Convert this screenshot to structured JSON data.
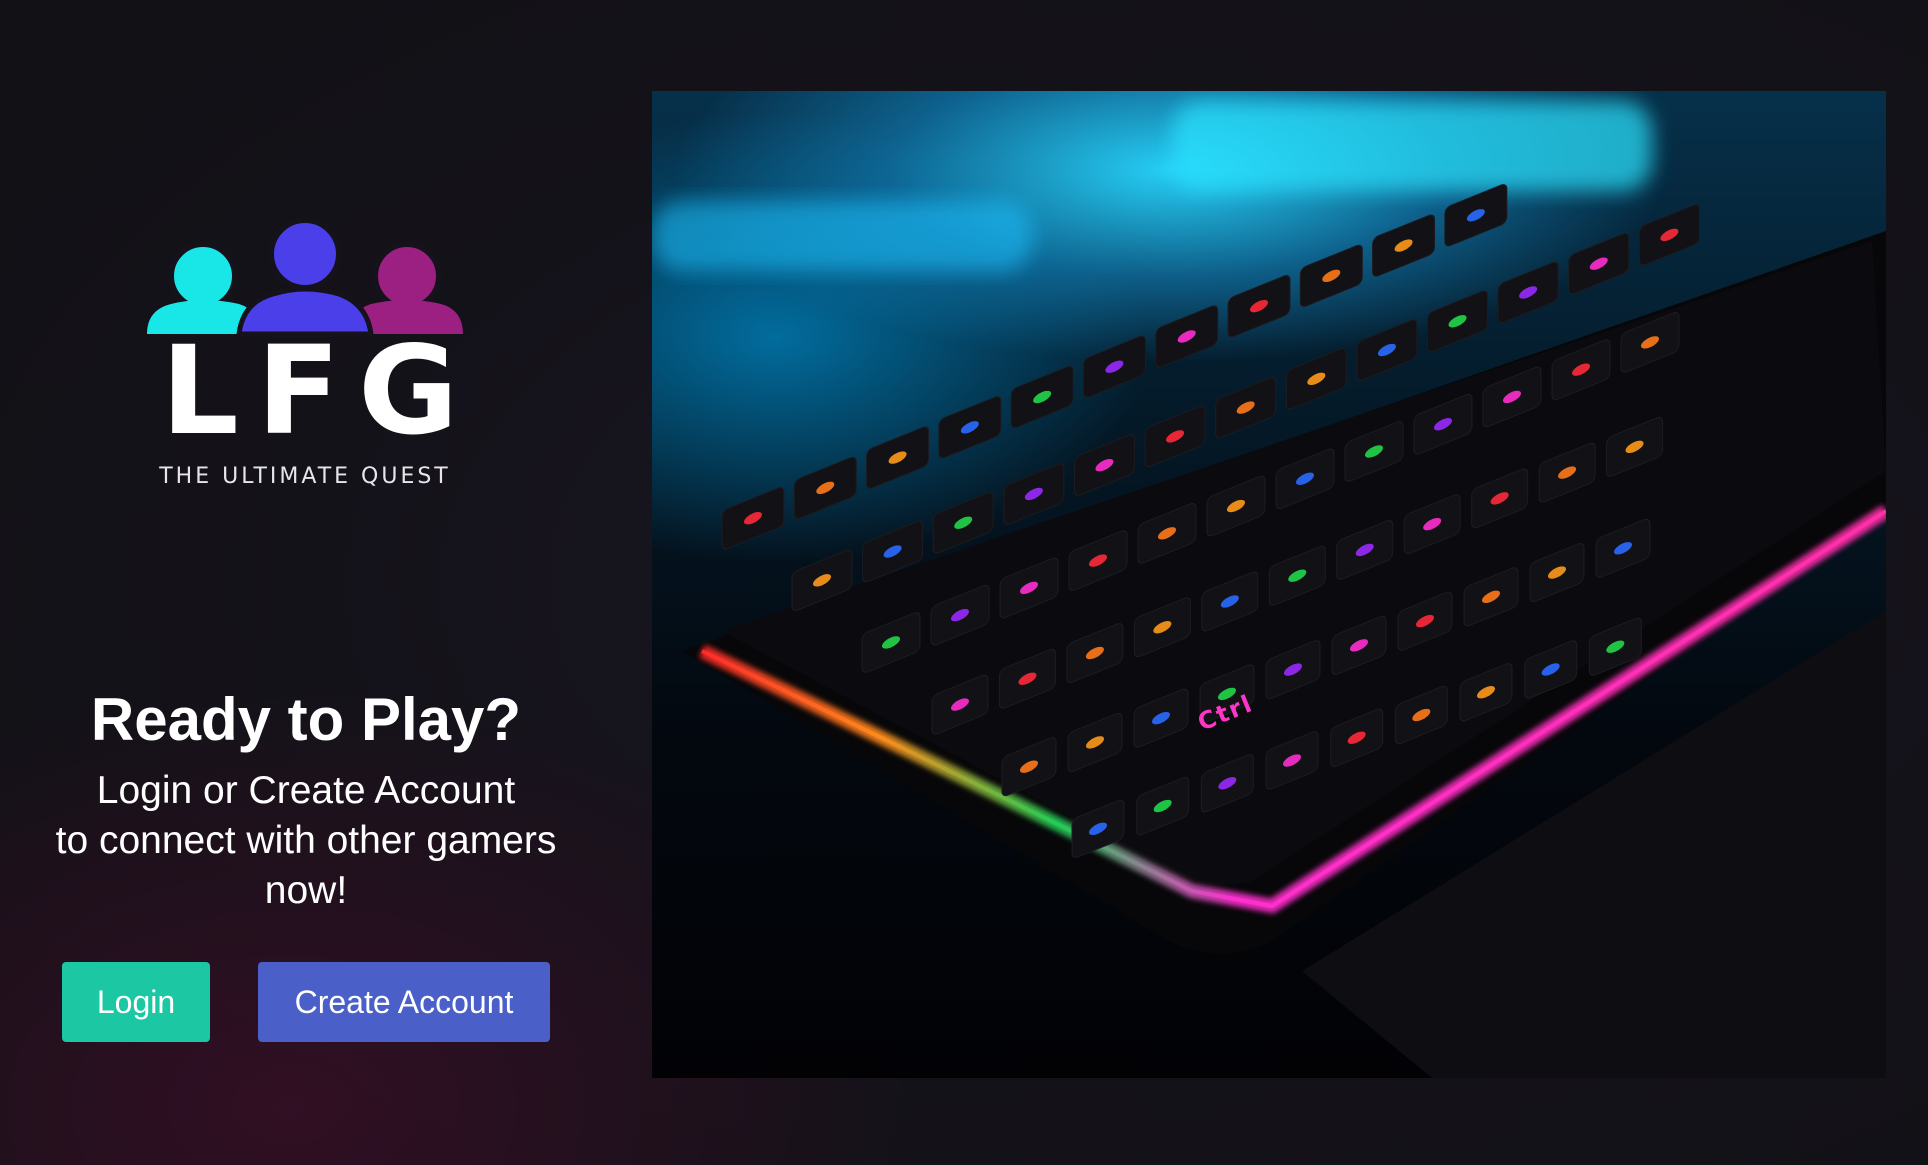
{
  "brand": {
    "logo_text": "LFG",
    "tagline": "THE ULTIMATE QUEST",
    "colors": {
      "person_left": "#19e6e6",
      "person_center": "#4a3fe8",
      "person_right": "#9c1f82"
    }
  },
  "hero_text": {
    "headline": "Ready to Play?",
    "subtext_lines": [
      "Login or Create Account",
      "to connect with other gamers",
      "now!"
    ]
  },
  "buttons": {
    "login_label": "Login",
    "create_account_label": "Create Account"
  },
  "colors": {
    "login_button": "#1cc8a3",
    "create_account_button": "#4a5fc7",
    "background": "#141219"
  },
  "hero_image": {
    "subject": "rgb-keyboard-photo",
    "key_legends": [
      "Ctrl"
    ]
  }
}
